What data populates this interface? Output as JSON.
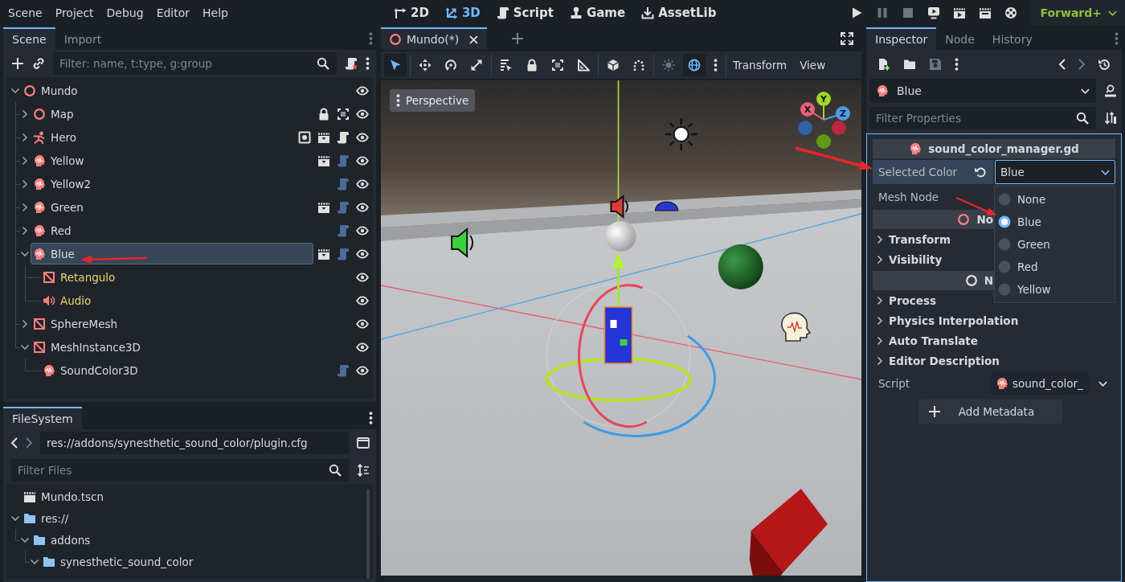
{
  "menu_bar": {
    "menus": [
      "Scene",
      "Project",
      "Debug",
      "Editor",
      "Help"
    ]
  },
  "workspaces": [
    {
      "label": "2D",
      "kind": "planar",
      "selected": false
    },
    {
      "label": "3D",
      "kind": "spatial",
      "selected": true
    },
    {
      "label": "Script",
      "kind": "script",
      "selected": false
    },
    {
      "label": "Game",
      "kind": "game",
      "selected": false
    },
    {
      "label": "AssetLib",
      "kind": "assetlib",
      "selected": false
    }
  ],
  "run_bar": {
    "buttons": [
      {
        "kind": "play",
        "disabled": false
      },
      {
        "kind": "pause",
        "disabled": true
      },
      {
        "kind": "stop",
        "disabled": true
      },
      {
        "kind": "remote",
        "disabled": false
      },
      {
        "kind": "play_scene",
        "disabled": false
      },
      {
        "kind": "play_custom",
        "disabled": false
      },
      {
        "kind": "movie",
        "disabled": false
      }
    ],
    "renderer": "Forward+"
  },
  "scene_dock": {
    "tabs": [
      {
        "label": "Scene",
        "selected": true
      },
      {
        "label": "Import",
        "selected": false
      }
    ],
    "filter": {
      "placeholder": "Filter: name, t:type, g:group"
    },
    "tree": [
      {
        "name": "Mundo",
        "kind": "node3d",
        "expanded": true,
        "selected": false,
        "from_instance": false,
        "visible": true,
        "children": [
          {
            "name": "Map",
            "kind": "node3d",
            "expanded": false,
            "selected": false,
            "from_instance": false,
            "visible": true,
            "badges": [
              {
                "kind": "lock"
              },
              {
                "kind": "group"
              }
            ]
          },
          {
            "name": "Hero",
            "kind": "character",
            "expanded": false,
            "selected": false,
            "from_instance": false,
            "visible": true,
            "badges": [
              {
                "kind": "unique"
              },
              {
                "kind": "clapper"
              },
              {
                "kind": "script"
              }
            ]
          },
          {
            "name": "Yellow",
            "kind": "sound",
            "expanded": false,
            "selected": false,
            "from_instance": false,
            "visible": true,
            "badges": [
              {
                "kind": "clapper"
              },
              {
                "kind": "script_dim"
              }
            ]
          },
          {
            "name": "Yellow2",
            "kind": "sound",
            "expanded": false,
            "selected": false,
            "from_instance": false,
            "visible": true,
            "badges": [
              {
                "kind": "script_dim"
              }
            ]
          },
          {
            "name": "Green",
            "kind": "sound",
            "expanded": false,
            "selected": false,
            "from_instance": false,
            "visible": true,
            "badges": [
              {
                "kind": "clapper"
              },
              {
                "kind": "script_dim"
              }
            ]
          },
          {
            "name": "Red",
            "kind": "sound",
            "expanded": false,
            "selected": false,
            "from_instance": false,
            "visible": true,
            "badges": [
              {
                "kind": "script_dim"
              }
            ]
          },
          {
            "name": "Blue",
            "kind": "sound",
            "expanded": true,
            "selected": true,
            "from_instance": false,
            "visible": true,
            "badges": [
              {
                "kind": "clapper"
              },
              {
                "kind": "script_dim"
              }
            ],
            "children": [
              {
                "name": "Retangulo",
                "kind": "mesh",
                "selected": false,
                "from_instance": true,
                "visible": true
              },
              {
                "name": "Audio",
                "kind": "audio",
                "selected": false,
                "from_instance": true,
                "visible": true
              }
            ]
          },
          {
            "name": "SphereMesh",
            "kind": "mesh",
            "expanded": false,
            "selected": false,
            "from_instance": false,
            "visible": true
          },
          {
            "name": "MeshInstance3D",
            "kind": "mesh",
            "expanded": true,
            "selected": false,
            "from_instance": false,
            "visible": true,
            "children": [
              {
                "name": "SoundColor3D",
                "kind": "sound",
                "selected": false,
                "from_instance": false,
                "visible": true,
                "badges": [
                  {
                    "kind": "script_dim"
                  }
                ]
              }
            ]
          }
        ]
      }
    ]
  },
  "filesystem_dock": {
    "tabs": [
      {
        "label": "FileSystem",
        "selected": true
      }
    ],
    "nav": [
      {
        "kind": "back",
        "disabled": false
      },
      {
        "kind": "forward",
        "disabled": true
      }
    ],
    "path": "res://addons/synesthetic_sound_color/plugin.cfg",
    "filter": {
      "placeholder": "Filter Files"
    },
    "files": [
      {
        "name": "Mundo.tscn",
        "kind": "scene"
      },
      {
        "name": "res://",
        "kind": "folder",
        "expanded": true,
        "children": [
          {
            "name": "addons",
            "kind": "folder",
            "expanded": true,
            "children": [
              {
                "name": "synesthetic_sound_color",
                "kind": "folder",
                "expanded": true
              }
            ]
          }
        ]
      }
    ]
  },
  "editor": {
    "tabs": [
      {
        "label": "Mundo(*)",
        "selected": true
      }
    ],
    "toolbar": {
      "groups": [
        {
          "tools": [
            {
              "kind": "select",
              "active": true,
              "disabled": false
            }
          ]
        },
        {
          "tools": [
            {
              "kind": "move",
              "active": false,
              "disabled": false
            },
            {
              "kind": "rotate",
              "active": false,
              "disabled": false
            },
            {
              "kind": "scale",
              "active": false,
              "disabled": false
            }
          ]
        },
        {
          "tools": [
            {
              "kind": "list_select",
              "active": false,
              "disabled": false
            },
            {
              "kind": "lock",
              "active": false,
              "disabled": false
            },
            {
              "kind": "group",
              "active": false,
              "disabled": false
            },
            {
              "kind": "ruler",
              "active": false,
              "disabled": false
            }
          ]
        },
        {
          "tools": [
            {
              "kind": "local",
              "active": false,
              "disabled": false
            },
            {
              "kind": "snap",
              "active": false,
              "disabled": false
            }
          ]
        },
        {
          "tools": [
            {
              "kind": "sun",
              "active": false,
              "disabled": true
            },
            {
              "kind": "environment",
              "active": true,
              "disabled": false
            },
            {
              "kind": "more",
              "active": false,
              "disabled": false
            }
          ]
        }
      ],
      "menus": [
        "Transform",
        "View"
      ]
    },
    "viewport": {
      "view_menu": "Perspective",
      "gizmo_axes": [
        {
          "label": "X",
          "color": "#e8607a"
        },
        {
          "label": "Y",
          "color": "#9fd62a"
        },
        {
          "label": "Z",
          "color": "#4e9be6"
        },
        {
          "color": "#2f63a8"
        },
        {
          "color": "#b8283e"
        },
        {
          "color": "#5f9a14"
        }
      ]
    }
  },
  "inspector_dock": {
    "tabs": [
      {
        "label": "Inspector",
        "selected": true
      },
      {
        "label": "Node",
        "selected": false
      },
      {
        "label": "History",
        "selected": false
      }
    ],
    "toolbar": {
      "file": [
        {
          "kind": "new",
          "disabled": false
        },
        {
          "kind": "open",
          "disabled": false
        },
        {
          "kind": "save",
          "disabled": true
        },
        {
          "kind": "more",
          "disabled": false
        }
      ],
      "history": [
        {
          "kind": "back",
          "disabled": false
        },
        {
          "kind": "forward",
          "disabled": true
        },
        {
          "kind": "history",
          "disabled": false
        }
      ]
    },
    "object": {
      "name": "Blue",
      "kind": "sound"
    },
    "filter": {
      "placeholder": "Filter Properties"
    },
    "sections": [
      {
        "kind": "script_header",
        "title": "sound_color_manager.gd"
      },
      {
        "kind": "enum_property",
        "label": "Selected Color",
        "selected": true,
        "revert": true,
        "value": "Blue",
        "focused": true,
        "options": [
          {
            "label": "None",
            "selected": false
          },
          {
            "label": "Blue",
            "selected": true
          },
          {
            "label": "Green",
            "selected": false
          },
          {
            "label": "Red",
            "selected": false
          },
          {
            "label": "Yellow",
            "selected": false
          }
        ]
      },
      {
        "kind": "property",
        "label": "Mesh Node",
        "selected": false,
        "revert": false
      },
      {
        "kind": "node3d_header",
        "title": "No"
      },
      {
        "kind": "group",
        "label": "Transform",
        "expanded": false
      },
      {
        "kind": "group",
        "label": "Visibility",
        "expanded": false
      },
      {
        "kind": "node_header",
        "title": "N"
      },
      {
        "kind": "group",
        "label": "Process",
        "expanded": false
      },
      {
        "kind": "group",
        "label": "Physics Interpolation",
        "expanded": false
      },
      {
        "kind": "group",
        "label": "Auto Translate",
        "expanded": false
      },
      {
        "kind": "group",
        "label": "Editor Description",
        "expanded": false
      },
      {
        "kind": "resource_property",
        "label": "Script",
        "selected": false,
        "revert": false,
        "value": "sound_color_"
      },
      {
        "kind": "button",
        "label": "Add Metadata"
      }
    ]
  }
}
